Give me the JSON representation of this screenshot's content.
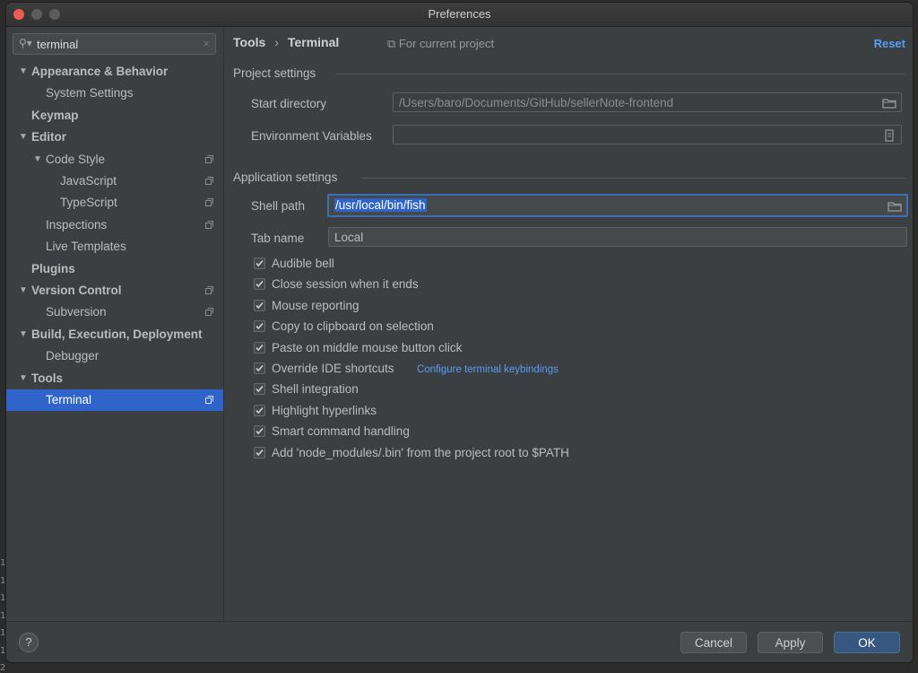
{
  "window": {
    "title": "Preferences"
  },
  "search": {
    "value": "terminal"
  },
  "tree": [
    {
      "label": "Appearance & Behavior",
      "bold": true,
      "arrow": true,
      "indent": 0,
      "project": false
    },
    {
      "label": "System Settings",
      "bold": false,
      "arrow": false,
      "indent": 1,
      "project": false
    },
    {
      "label": "Keymap",
      "bold": true,
      "arrow": false,
      "indent": 0,
      "project": false
    },
    {
      "label": "Editor",
      "bold": true,
      "arrow": true,
      "indent": 0,
      "project": false
    },
    {
      "label": "Code Style",
      "bold": false,
      "arrow": true,
      "indent": 1,
      "project": true
    },
    {
      "label": "JavaScript",
      "bold": false,
      "arrow": false,
      "indent": 2,
      "project": true
    },
    {
      "label": "TypeScript",
      "bold": false,
      "arrow": false,
      "indent": 2,
      "project": true
    },
    {
      "label": "Inspections",
      "bold": false,
      "arrow": false,
      "indent": 1,
      "project": true
    },
    {
      "label": "Live Templates",
      "bold": false,
      "arrow": false,
      "indent": 1,
      "project": false
    },
    {
      "label": "Plugins",
      "bold": true,
      "arrow": false,
      "indent": 0,
      "project": false
    },
    {
      "label": "Version Control",
      "bold": true,
      "arrow": true,
      "indent": 0,
      "project": true
    },
    {
      "label": "Subversion",
      "bold": false,
      "arrow": false,
      "indent": 1,
      "project": true
    },
    {
      "label": "Build, Execution, Deployment",
      "bold": true,
      "arrow": true,
      "indent": 0,
      "project": false
    },
    {
      "label": "Debugger",
      "bold": false,
      "arrow": false,
      "indent": 1,
      "project": false
    },
    {
      "label": "Tools",
      "bold": true,
      "arrow": true,
      "indent": 0,
      "project": false
    },
    {
      "label": "Terminal",
      "bold": false,
      "arrow": false,
      "indent": 1,
      "project": true,
      "selected": true
    }
  ],
  "breadcrumb": {
    "parent": "Tools",
    "separator": "›",
    "current": "Terminal"
  },
  "scope_label": "For current project",
  "reset_label": "Reset",
  "project_settings": {
    "title": "Project settings",
    "start_directory_label": "Start directory",
    "start_directory_value": "/Users/baro/Documents/GitHub/sellerNote-frontend",
    "env_vars_label": "Environment Variables",
    "env_vars_value": ""
  },
  "application_settings": {
    "title": "Application settings",
    "shell_path_label": "Shell path",
    "shell_path_value": "/usr/local/bin/fish",
    "tab_name_label": "Tab name",
    "tab_name_value": "Local"
  },
  "options": [
    {
      "label": "Audible bell",
      "checked": true
    },
    {
      "label": "Close session when it ends",
      "checked": true
    },
    {
      "label": "Mouse reporting",
      "checked": true
    },
    {
      "label": "Copy to clipboard on selection",
      "checked": true
    },
    {
      "label": "Paste on middle mouse button click",
      "checked": true
    },
    {
      "label": "Override IDE shortcuts",
      "checked": true,
      "link": "Configure terminal keybindings"
    },
    {
      "label": "Shell integration",
      "checked": true
    },
    {
      "label": "Highlight hyperlinks",
      "checked": true
    },
    {
      "label": "Smart command handling",
      "checked": true
    },
    {
      "label": "Add 'node_modules/.bin' from the project root to $PATH",
      "checked": true
    }
  ],
  "footer": {
    "help_label": "?",
    "cancel_label": "Cancel",
    "apply_label": "Apply",
    "ok_label": "OK"
  },
  "background_gutter": [
    "1",
    "1",
    "1",
    "1",
    "1",
    "1",
    "2"
  ],
  "colors": {
    "accent": "#2f65ca",
    "link": "#589df6",
    "ok_button": "#365880"
  }
}
